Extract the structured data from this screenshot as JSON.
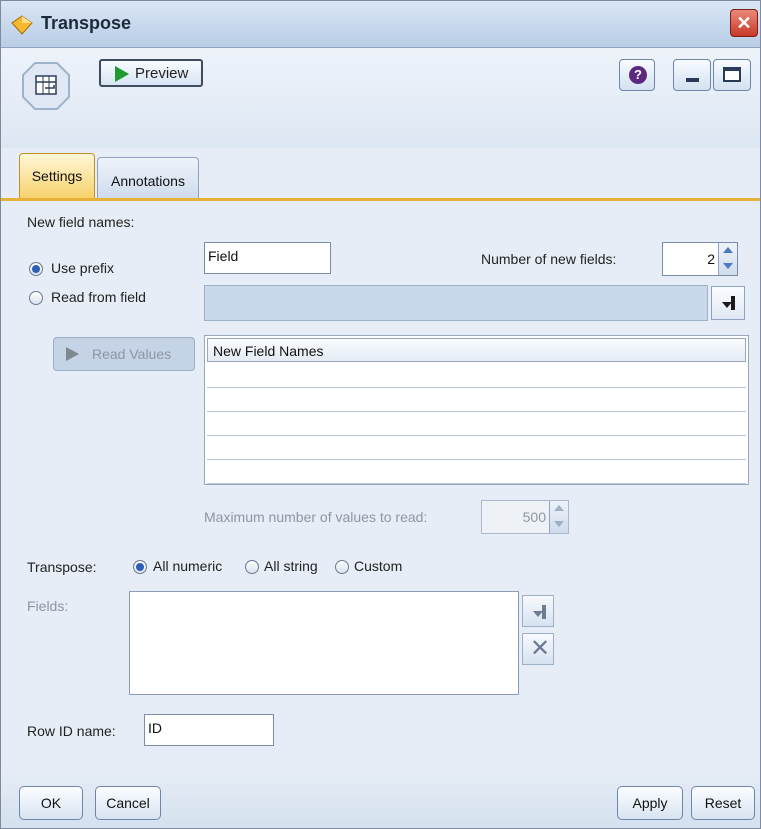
{
  "window": {
    "title": "Transpose",
    "close_glyph": "✕"
  },
  "toolbar": {
    "preview_label": "Preview",
    "help_glyph": "?"
  },
  "tabs": [
    {
      "label": "Settings",
      "selected": true
    },
    {
      "label": "Annotations",
      "selected": false
    }
  ],
  "settings": {
    "new_field_names_label": "New field names:",
    "use_prefix_label": "Use prefix",
    "use_prefix_checked": true,
    "prefix_value": "Field",
    "number_of_new_fields_label": "Number of new fields:",
    "number_of_new_fields_value": "2",
    "read_from_field_label": "Read from field",
    "read_from_field_checked": false,
    "read_values_label": "Read Values",
    "grid_header": "New Field Names",
    "grid_rows": [
      "",
      "",
      "",
      "",
      ""
    ],
    "max_values_label": "Maximum number of values to read:",
    "max_values_value": "500",
    "transpose_label": "Transpose:",
    "transpose_options": [
      {
        "label": "All numeric",
        "checked": true
      },
      {
        "label": "All string",
        "checked": false
      },
      {
        "label": "Custom",
        "checked": false
      }
    ],
    "fields_label": "Fields:",
    "row_id_label": "Row ID name:",
    "row_id_value": "ID"
  },
  "footer": {
    "ok_label": "OK",
    "cancel_label": "Cancel",
    "apply_label": "Apply",
    "reset_label": "Reset"
  },
  "colors": {
    "accent_tab": "#f6d26b",
    "dialog_bg": "#e6edf6",
    "close_red": "#c8382a"
  }
}
